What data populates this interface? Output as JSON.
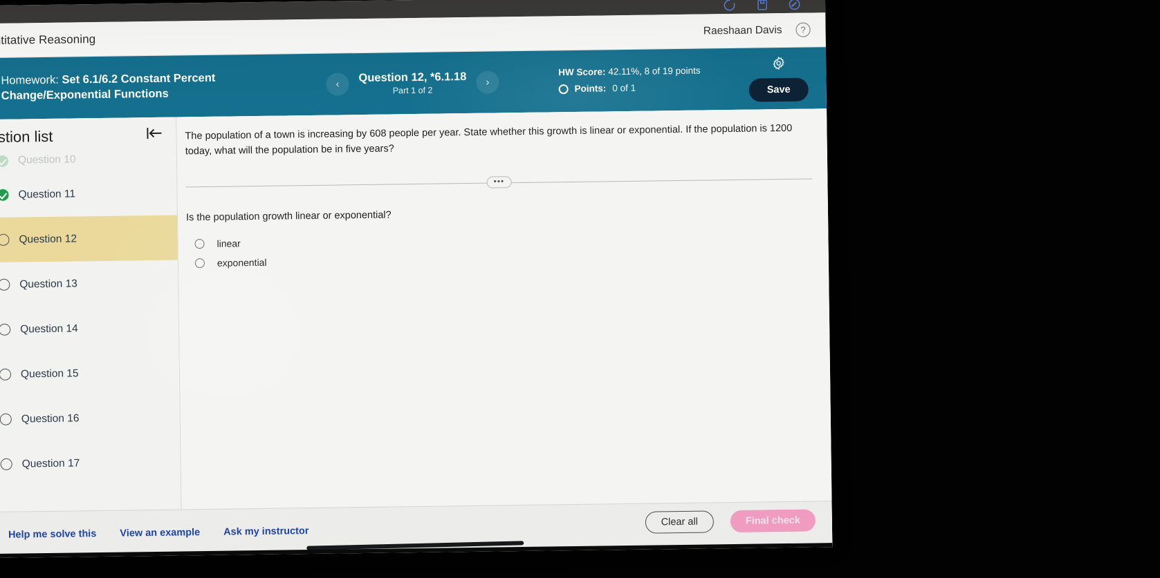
{
  "os_bar": {
    "icons": [
      "loading-spinner-icon",
      "save-document-icon",
      "edit-pencil-icon"
    ]
  },
  "app_bar": {
    "course_title": "uantitative Reasoning",
    "user_name": "Raeshaan Davis",
    "help_label": "?"
  },
  "hw_bar": {
    "homework_label": "Homework:",
    "homework_value": "Set 6.1/6.2 Constant Percent Change/Exponential Functions",
    "prev_label": "‹",
    "next_label": "›",
    "question_title": "Question 12, *6.1.18",
    "question_part": "Part 1 of 2",
    "hw_score_label": "HW Score:",
    "hw_score_value": "42.11%, 8 of 19 points",
    "points_label": "Points:",
    "points_value": "0 of 1",
    "save_label": "Save"
  },
  "sidebar": {
    "title": "uestion list",
    "collapse_icon": "collapse-panel-icon",
    "items": [
      {
        "label": "Question 10",
        "state": "done",
        "active": false,
        "cut": true
      },
      {
        "label": "Question 11",
        "state": "done",
        "active": false,
        "cut": false
      },
      {
        "label": "Question 12",
        "state": "pending",
        "active": true,
        "cut": false
      },
      {
        "label": "Question 13",
        "state": "pending",
        "active": false,
        "cut": false
      },
      {
        "label": "Question 14",
        "state": "pending",
        "active": false,
        "cut": false
      },
      {
        "label": "Question 15",
        "state": "pending",
        "active": false,
        "cut": false
      },
      {
        "label": "Question 16",
        "state": "pending",
        "active": false,
        "cut": false
      },
      {
        "label": "Question 17",
        "state": "pending",
        "active": false,
        "cut": false
      }
    ]
  },
  "content": {
    "question_text": "The population of a town is increasing by 608 people per year. State whether this growth is linear or exponential. If the population is 1200 today, what will the population be in five years?",
    "divider_dots": "•••",
    "prompt": "Is the population growth linear or exponential?",
    "choices": [
      {
        "label": "linear",
        "selected": false
      },
      {
        "label": "exponential",
        "selected": false
      }
    ]
  },
  "bottom_bar": {
    "links": [
      "Help me solve this",
      "View an example",
      "Ask my instructor"
    ],
    "clear_all_label": "Clear all",
    "final_check_label": "Final check"
  },
  "colors": {
    "teal_header": "#14708e",
    "save_button": "#0d2235",
    "active_row": "#ead99a",
    "link_blue": "#1f44a8",
    "final_check_pink": "#ef9cc0",
    "done_green": "#1f9d4d"
  }
}
